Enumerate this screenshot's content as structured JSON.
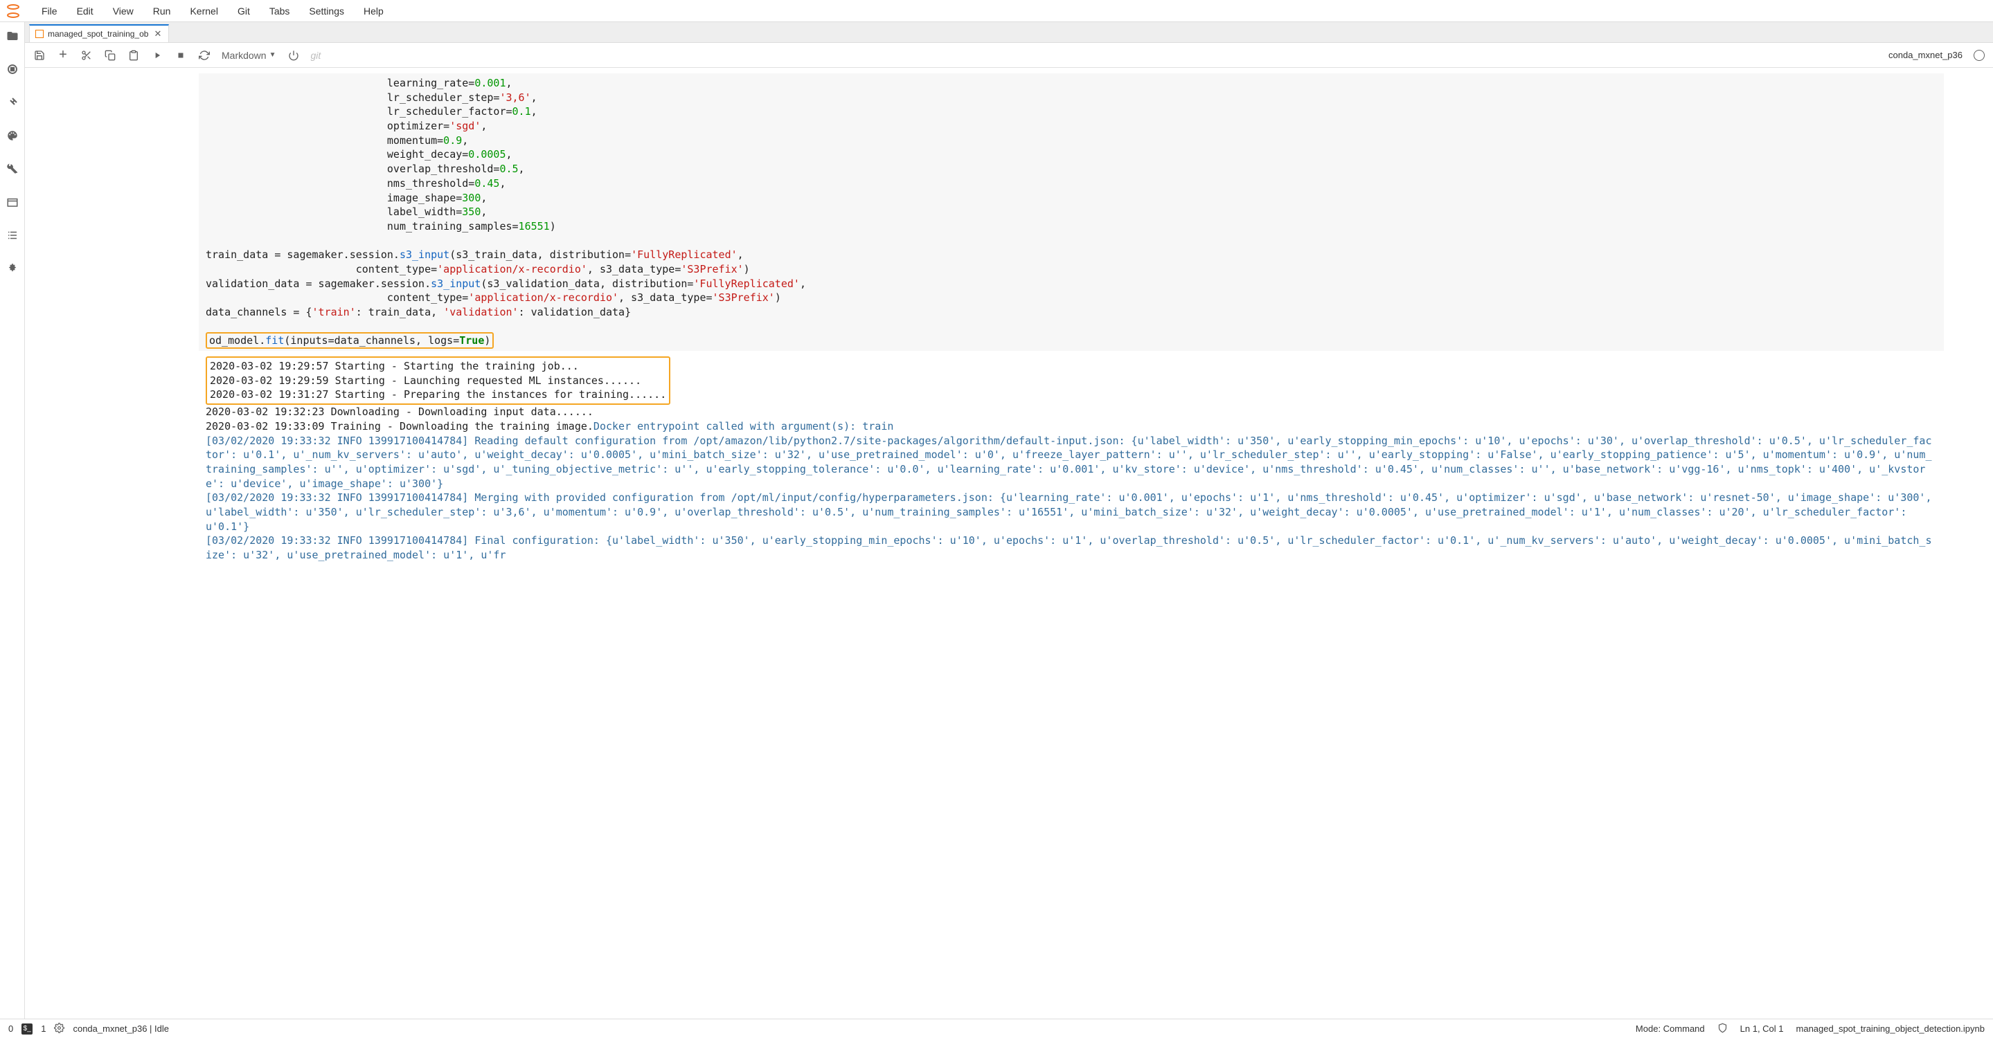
{
  "menu": {
    "items": [
      "File",
      "Edit",
      "View",
      "Run",
      "Kernel",
      "Git",
      "Tabs",
      "Settings",
      "Help"
    ]
  },
  "tab": {
    "title": "managed_spot_training_ob"
  },
  "toolbar": {
    "cellType": "Markdown",
    "git": "git",
    "kernel": "conda_mxnet_p36"
  },
  "code": {
    "hp1": "                             learning_rate=",
    "hp1v": "0.001",
    "hp1e": ",",
    "hp2": "                             lr_scheduler_step=",
    "hp2v": "'3,6'",
    "hp2e": ",",
    "hp3": "                             lr_scheduler_factor=",
    "hp3v": "0.1",
    "hp3e": ",",
    "hp4": "                             optimizer=",
    "hp4v": "'sgd'",
    "hp4e": ",",
    "hp5": "                             momentum=",
    "hp5v": "0.9",
    "hp5e": ",",
    "hp6": "                             weight_decay=",
    "hp6v": "0.0005",
    "hp6e": ",",
    "hp7": "                             overlap_threshold=",
    "hp7v": "0.5",
    "hp7e": ",",
    "hp8": "                             nms_threshold=",
    "hp8v": "0.45",
    "hp8e": ",",
    "hp9": "                             image_shape=",
    "hp9v": "300",
    "hp9e": ",",
    "hp10": "                             label_width=",
    "hp10v": "350",
    "hp10e": ",",
    "hp11": "                             num_training_samples=",
    "hp11v": "16551",
    "hp11e": ")",
    "t1a": "train_data = sagemaker.session.",
    "t1f": "s3_input",
    "t1b": "(s3_train_data, distribution=",
    "t1s": "'FullyReplicated'",
    "t1c": ",",
    "t2a": "                        content_type=",
    "t2s1": "'application/x-recordio'",
    "t2b": ", s3_data_type=",
    "t2s2": "'S3Prefix'",
    "t2c": ")",
    "t3a": "validation_data = sagemaker.session.",
    "t3f": "s3_input",
    "t3b": "(s3_validation_data, distribution=",
    "t3s": "'FullyReplicated'",
    "t3c": ",",
    "t4a": "                             content_type=",
    "t4s1": "'application/x-recordio'",
    "t4b": ", s3_data_type=",
    "t4s2": "'S3Prefix'",
    "t4c": ")",
    "t5a": "data_channels = {",
    "t5s1": "'train'",
    "t5b": ": train_data, ",
    "t5s2": "'validation'",
    "t5c": ": validation_data}",
    "fitA": "od_model.",
    "fitF": "fit",
    "fitB": "(inputs=data_channels, logs=",
    "fitK": "True",
    "fitC": ")"
  },
  "out": {
    "l1": "2020-03-02 19:29:57 Starting - Starting the training job...",
    "l2": "2020-03-02 19:29:59 Starting - Launching requested ML instances......",
    "l3": "2020-03-02 19:31:27 Starting - Preparing the instances for training......",
    "l4": "2020-03-02 19:32:23 Downloading - Downloading input data......",
    "l5a": "2020-03-02 19:33:09 Training - Downloading the training image.",
    "l5b": "Docker entrypoint called with argument(s): train",
    "b1": "[03/02/2020 19:33:32 INFO 139917100414784] Reading default configuration from /opt/amazon/lib/python2.7/site-packages/algorithm/default-input.json: {u'label_width': u'350', u'early_stopping_min_epochs': u'10', u'epochs': u'30', u'overlap_threshold': u'0.5', u'lr_scheduler_factor': u'0.1', u'_num_kv_servers': u'auto', u'weight_decay': u'0.0005', u'mini_batch_size': u'32', u'use_pretrained_model': u'0', u'freeze_layer_pattern': u'', u'lr_scheduler_step': u'', u'early_stopping': u'False', u'early_stopping_patience': u'5', u'momentum': u'0.9', u'num_training_samples': u'', u'optimizer': u'sgd', u'_tuning_objective_metric': u'', u'early_stopping_tolerance': u'0.0', u'learning_rate': u'0.001', u'kv_store': u'device', u'nms_threshold': u'0.45', u'num_classes': u'', u'base_network': u'vgg-16', u'nms_topk': u'400', u'_kvstore': u'device', u'image_shape': u'300'}",
    "b2": "[03/02/2020 19:33:32 INFO 139917100414784] Merging with provided configuration from /opt/ml/input/config/hyperparameters.json: {u'learning_rate': u'0.001', u'epochs': u'1', u'nms_threshold': u'0.45', u'optimizer': u'sgd', u'base_network': u'resnet-50', u'image_shape': u'300', u'label_width': u'350', u'lr_scheduler_step': u'3,6', u'momentum': u'0.9', u'overlap_threshold': u'0.5', u'num_training_samples': u'16551', u'mini_batch_size': u'32', u'weight_decay': u'0.0005', u'use_pretrained_model': u'1', u'num_classes': u'20', u'lr_scheduler_factor': u'0.1'}",
    "b3": "[03/02/2020 19:33:32 INFO 139917100414784] Final configuration: {u'label_width': u'350', u'early_stopping_min_epochs': u'10', u'epochs': u'1', u'overlap_threshold': u'0.5', u'lr_scheduler_factor': u'0.1', u'_num_kv_servers': u'auto', u'weight_decay': u'0.0005', u'mini_batch_size': u'32', u'use_pretrained_model': u'1', u'fr"
  },
  "status": {
    "zero": "0",
    "one": "1",
    "kernel": "conda_mxnet_p36 | Idle",
    "mode": "Mode: Command",
    "ln": "Ln 1, Col 1",
    "file": "managed_spot_training_object_detection.ipynb"
  }
}
